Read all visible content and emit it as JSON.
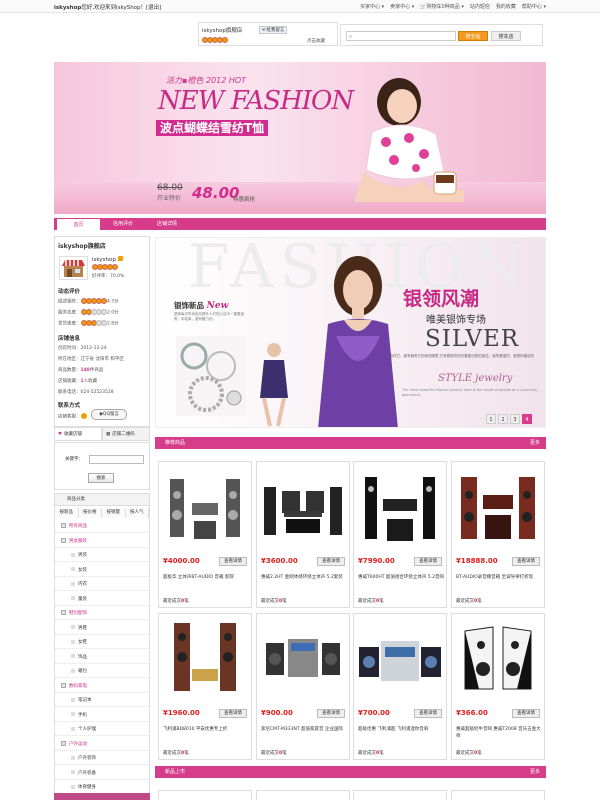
{
  "topbar": {
    "welcome_user": "iskyshop",
    "welcome_text": "您好,欢迎来到iskyShop！[退出]",
    "nav": [
      "买家中心",
      "卖家中心",
      "购物车0种商品",
      "站内短信",
      "我的收藏",
      "帮助中心"
    ]
  },
  "shopheader": {
    "shop_name": "iskyshop旗舰店",
    "contact_label": "给我留言",
    "collect_label": "点击收藏",
    "search_placeholder": "",
    "search_all_label": "搜全站",
    "search_shop_label": "搜本店"
  },
  "banner": {
    "line1": "活力▪橙色 2012 HOT",
    "line2": "NEW FASHION",
    "line3": "波点蝴蝶结雪纺T恤",
    "old_price": "68.00",
    "new_label": "开业特价",
    "new_price": "48.00",
    "tag": "特惠疯抢",
    "colors": {
      "pink": "#d63c8a",
      "magenta": "#c62a85"
    }
  },
  "tabs": [
    "首页",
    "信用评价",
    "店铺详情"
  ],
  "shop_info": {
    "title": "iskyshop旗舰店",
    "name": "iskyshop",
    "rate": "好评率：70.0%",
    "dynamic_title": "动态评价",
    "ratings": [
      {
        "label": "描述相符：",
        "score": "4.7分"
      },
      {
        "label": "服务态度：",
        "score": "2.0分"
      },
      {
        "label": "发货速度：",
        "score": "2.8分"
      }
    ],
    "info_title": "店铺信息",
    "info": [
      {
        "label": "创店时间：",
        "value": "2012-12-24"
      },
      {
        "label": "所在地区：",
        "value": "辽宁省 沈阳市 和平区"
      },
      {
        "label": "商品数量：",
        "count": "148",
        "value": "件商品"
      },
      {
        "label": "店铺收藏：",
        "count": "1",
        "value": "人收藏"
      },
      {
        "label": "联系电话：",
        "value": "024-52523528"
      }
    ],
    "contact_title": "联系方式",
    "wangwang_label": "店铺客服：",
    "qq_label": "QQ留言"
  },
  "favorite": {
    "collect": "收藏店铺",
    "qrcode": "店铺二维码"
  },
  "keyword": {
    "label": "关键字：",
    "button": "搜索"
  },
  "categories": {
    "title": "商品分类",
    "sort": [
      "按新品",
      "按价格",
      "按销量",
      "按人气"
    ],
    "items": [
      {
        "label": "所有商品",
        "level": "top"
      },
      {
        "label": "男女服装",
        "level": "top"
      },
      {
        "label": "男装",
        "level": "sub"
      },
      {
        "label": "女装",
        "level": "sub"
      },
      {
        "label": "内衣",
        "level": "sub"
      },
      {
        "label": "童装",
        "level": "sub"
      },
      {
        "label": "鞋包配饰",
        "level": "top"
      },
      {
        "label": "男鞋",
        "level": "sub"
      },
      {
        "label": "女鞋",
        "level": "sub"
      },
      {
        "label": "饰品",
        "level": "sub"
      },
      {
        "label": "箱包",
        "level": "sub"
      },
      {
        "label": "数码家电",
        "level": "top"
      },
      {
        "label": "笔记本",
        "level": "sub"
      },
      {
        "label": "手机",
        "level": "sub"
      },
      {
        "label": "个人护理",
        "level": "sub"
      },
      {
        "label": "户外运动",
        "level": "top"
      },
      {
        "label": "户外装饰",
        "level": "sub"
      },
      {
        "label": "户外装备",
        "level": "sub"
      },
      {
        "label": "体育健身",
        "level": "sub"
      }
    ]
  },
  "promo": {
    "bg_text": "FASHION",
    "left_title": "银饰新品",
    "left_script": "New",
    "left_desc": "银饰每次时尚走向是外人们的心目中一直垂涎角，年轻事，重有魅力的。",
    "title": "银领风潮",
    "subtitle": "唯美银饰专场",
    "silver": "SILVER",
    "desc": "一范时拦，被有拥有它的我的眼里,它有着那样的光着魔法般的迷恋，我所看重的，就是你喜欢的",
    "style": "STYLE jewelry",
    "style_desc": "The most beautiful fashion jewelry here is the result of people at a Luxurious, glamorous",
    "pages": [
      "1",
      "2",
      "3",
      "4"
    ]
  },
  "recommend": {
    "title": "推荐商品",
    "more": "更多"
  },
  "newarrivals": {
    "title": "新品上市",
    "more": "更多"
  },
  "product_labels": {
    "detail": "查看详情",
    "sold_prefix": "最近成交",
    "sold_suffix": "笔"
  },
  "products": [
    {
      "price": "¥4000.00",
      "name": "超极华 立体声BT-AUDIO 音箱 影院",
      "sold": "0",
      "icon": "tower-speaker-set-icon"
    },
    {
      "price": "¥3600.00",
      "name": "惠威2.2HT 金刚体感环绕立体声 5.2套装",
      "sold": "0",
      "icon": "home-theater-set-icon"
    },
    {
      "price": "¥7990.00",
      "name": "惠威T600HT 超值组合环绕立体声 5.2音响",
      "sold": "0",
      "icon": "black-speaker-set-icon"
    },
    {
      "price": "¥18888.00",
      "name": "BT-AUDIO录音棚音箱 至诚导律打折现",
      "sold": "0",
      "icon": "wood-speaker-set-icon"
    },
    {
      "price": "¥1960.00",
      "name": "飞利浦BD8010 平安优惠专上折",
      "sold": "0",
      "icon": "floorstanding-speaker-icon"
    },
    {
      "price": "¥900.00",
      "name": "索尼CMT-M333NT 超值家庭音 企业国际",
      "sold": "0",
      "icon": "mini-stereo-icon"
    },
    {
      "price": "¥700.00",
      "name": "超级优惠 飞利浦超 飞利浦迷你音响",
      "sold": "0",
      "icon": "micro-stereo-icon"
    },
    {
      "price": "¥366.00",
      "name": "惠威超级奶牛音响 惠威T200B 音乐五金大师",
      "sold": "0",
      "icon": "bookshelf-speaker-icon"
    }
  ]
}
